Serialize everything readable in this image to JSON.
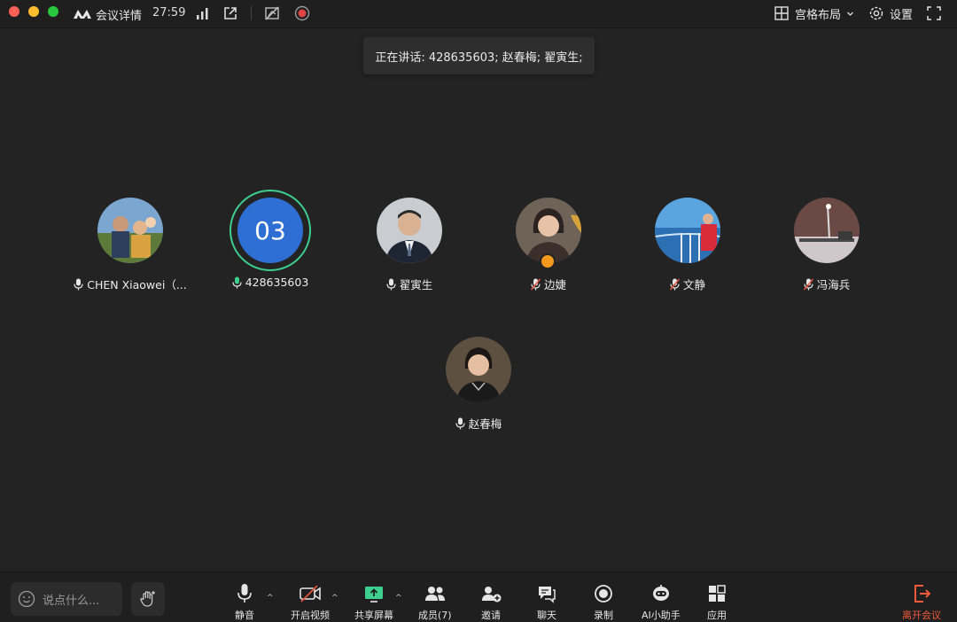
{
  "topbar": {
    "meeting_info": "会议详情",
    "timer": "27:59",
    "layout_label": "宫格布局",
    "settings_label": "设置"
  },
  "speaking": {
    "text": "正在讲话: 428635603; 赵春梅; 翟寅生;"
  },
  "participants": [
    {
      "name": "CHEN Xiaowei（...",
      "mic": "on"
    },
    {
      "name": "428635603",
      "initials": "03",
      "mic": "active"
    },
    {
      "name": "翟寅生",
      "mic": "on"
    },
    {
      "name": "边婕",
      "mic": "muted"
    },
    {
      "name": "文静",
      "mic": "muted"
    },
    {
      "name": "冯海兵",
      "mic": "muted"
    },
    {
      "name": "赵春梅",
      "mic": "on"
    }
  ],
  "toolbar": {
    "chat_placeholder": "说点什么...",
    "mute": "静音",
    "video": "开启视频",
    "share": "共享屏幕",
    "members": "成员(7)",
    "invite": "邀请",
    "chat": "聊天",
    "record": "录制",
    "ai": "AI小助手",
    "apps": "应用",
    "leave": "离开会议"
  },
  "colors": {
    "background": "#232323",
    "speaking_ring": "#3ecf8e",
    "avatar_blue": "#2f6fd4",
    "leave_red": "#f05a3c",
    "share_green": "#3ecf8e"
  }
}
